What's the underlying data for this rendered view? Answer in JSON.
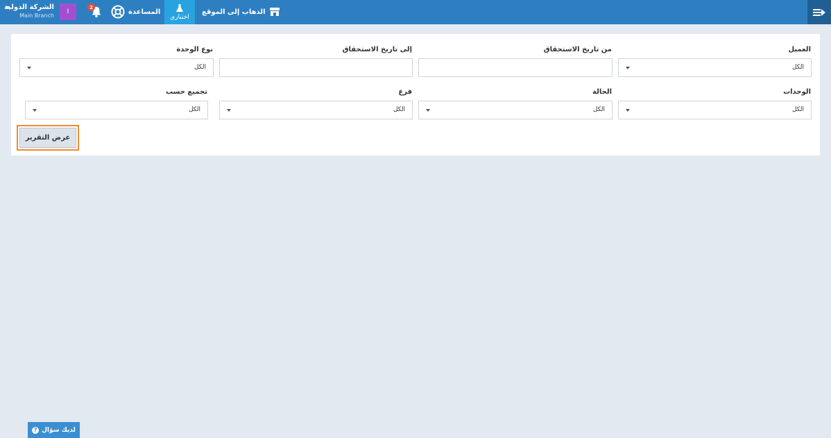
{
  "topbar": {
    "company_name": "الشركة الدولية",
    "branch_name": "Main Branch",
    "avatar_text": "I",
    "notifications_count": "2",
    "help_label": "المساعدة",
    "test_label": "اختباري",
    "goto_site_label": "الذهاب إلى الموقع"
  },
  "form": {
    "fields": [
      {
        "label": "العميل",
        "value": "الكل"
      },
      {
        "label": "من تاريخ الاستحقاق",
        "value": ""
      },
      {
        "label": "إلى تاريخ الاستحقاق",
        "value": ""
      },
      {
        "label": "نوع الوحدة",
        "value": "الكل"
      },
      {
        "label": "الوحدات",
        "value": "الكل"
      },
      {
        "label": "الحالة",
        "value": "الكل"
      },
      {
        "label": "فرع",
        "value": "الكل"
      },
      {
        "label": "تجميع حسب",
        "value": "الكل"
      }
    ],
    "submit_label": "عرض التقرير"
  },
  "footer": {
    "question_label": "لديك سؤال"
  },
  "colors": {
    "topbar": "#2d7fc1",
    "active_tab": "#29a3e0",
    "highlight_border": "#f08b30",
    "avatar": "#a24fd0",
    "badge": "#e74c3c"
  }
}
